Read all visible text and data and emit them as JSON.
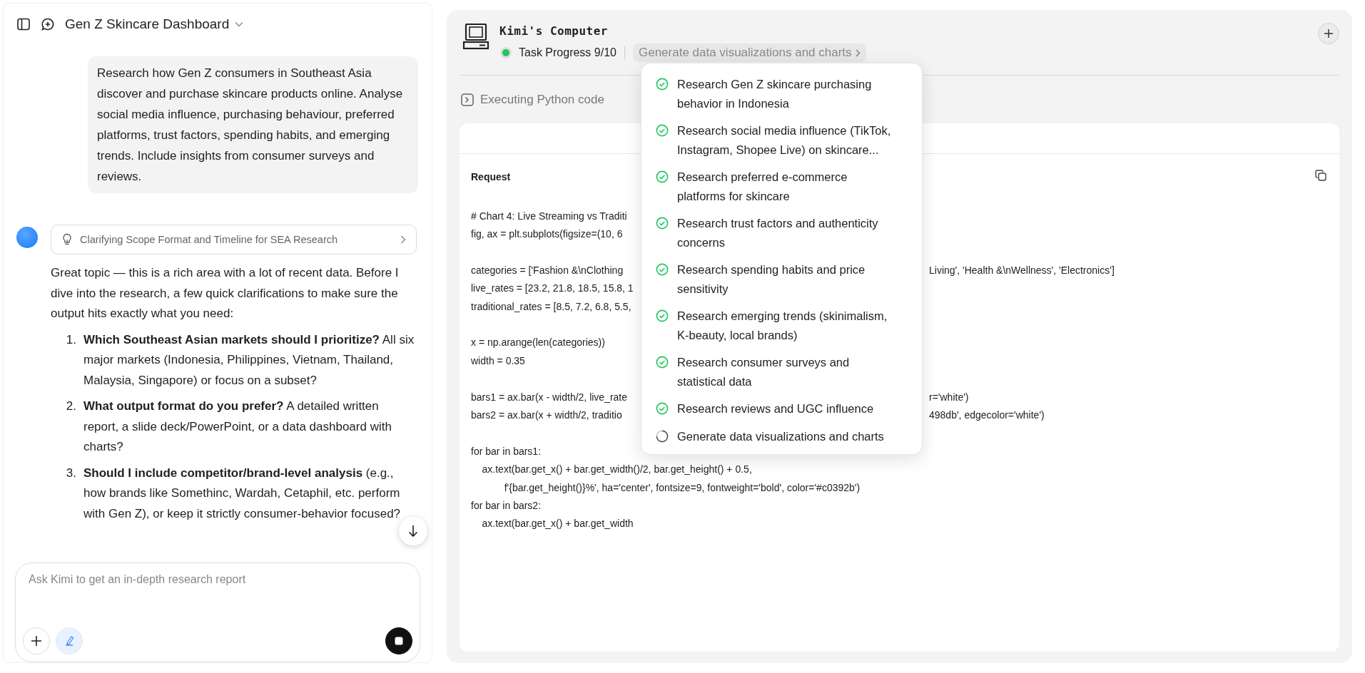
{
  "header": {
    "title": "Gen Z Skincare Dashboard"
  },
  "user_message": "Research how Gen Z consumers in Southeast Asia discover and purchase skincare products online. Analyse social media influence, purchasing behaviour, preferred platforms, trust factors, spending habits, and emerging trends. Include insights from consumer surveys and reviews.",
  "thinking": {
    "label": "Clarifying Scope Format and Timeline for SEA Research"
  },
  "answer": {
    "intro": "Great topic — this is a rich area with a lot of recent data. Before I dive into the research, a few quick clarifications to make sure the output hits exactly what you need:",
    "list": [
      {
        "number": "1.",
        "text": "**Which Southeast Asian markets should I prioritize?** All six major markets (Indonesia, Philippines, Vietnam, Thailand, Malaysia, Singapore) or focus on a subset?"
      },
      {
        "number": "2.",
        "text": "**What output format do you prefer?** A detailed written report, a slide deck/PowerPoint, or a data dashboard with charts?"
      },
      {
        "number": "3.",
        "text": "**Should I include competitor/brand-level analysis** (e.g., how brands like Somethinc, Wardah, Cetaphil, etc. perform with Gen Z), or keep it strictly consumer-behavior focused?"
      }
    ]
  },
  "composer": {
    "placeholder": "Ask Kimi to get an in-depth research report"
  },
  "computer": {
    "title": "Kimi's Computer",
    "progress": "Task Progress 9/10",
    "current_task": "Generate data visualizations and charts",
    "status": "Executing Python code",
    "request_label": "Request",
    "code_lines": [
      {
        "kind": "split",
        "left": "# Chart 4: Live Streaming vs Traditi"
      },
      {
        "kind": "split",
        "left": "fig, ax = plt.subplots(figsize=(10, 6"
      },
      {
        "kind": "blank"
      },
      {
        "kind": "split",
        "left": "categories = ['Fashion &\\nClothing",
        "right": "Living', 'Health &\\nWellness', 'Electronics']"
      },
      {
        "kind": "split",
        "left": "live_rates = [23.2, 21.8, 18.5, 15.8, 1"
      },
      {
        "kind": "split",
        "left": "traditional_rates = [8.5, 7.2, 6.8, 5.5,"
      },
      {
        "kind": "blank"
      },
      {
        "kind": "split",
        "left": "x = np.arange(len(categories))"
      },
      {
        "kind": "split",
        "left": "width = 0.35"
      },
      {
        "kind": "blank"
      },
      {
        "kind": "split",
        "left": "bars1 = ax.bar(x - width/2, live_rate",
        "right": "r='white')"
      },
      {
        "kind": "split",
        "left": "bars2 = ax.bar(x + width/2, traditio",
        "right": "498db', edgecolor='white')"
      },
      {
        "kind": "blank"
      },
      {
        "kind": "split",
        "left": "for bar in bars1:"
      },
      {
        "kind": "full",
        "text": "    ax.text(bar.get_x() + bar.get_width()/2, bar.get_height() + 0.5,"
      },
      {
        "kind": "full",
        "text": "            f'{bar.get_height()}%', ha='center', fontsize=9, fontweight='bold', color='#c0392b')"
      },
      {
        "kind": "full",
        "text": "for bar in bars2:"
      },
      {
        "kind": "full",
        "text": "    ax.text(bar.get_x() + bar.get_width"
      }
    ],
    "tasks": [
      {
        "label": "Research Gen Z skincare purchasing behavior in Indonesia",
        "done": true
      },
      {
        "label": "Research social media influence (TikTok, Instagram, Shopee Live) on skincare...",
        "done": true
      },
      {
        "label": "Research preferred e-commerce platforms for skincare",
        "done": true
      },
      {
        "label": "Research trust factors and authenticity concerns",
        "done": true
      },
      {
        "label": "Research spending habits and price sensitivity",
        "done": true
      },
      {
        "label": "Research emerging trends (skinimalism, K-beauty, local brands)",
        "done": true
      },
      {
        "label": "Research consumer surveys and statistical data",
        "done": true
      },
      {
        "label": "Research reviews and UGC influence",
        "done": true
      },
      {
        "label": "Generate data visualizations and charts",
        "done": false
      }
    ]
  }
}
